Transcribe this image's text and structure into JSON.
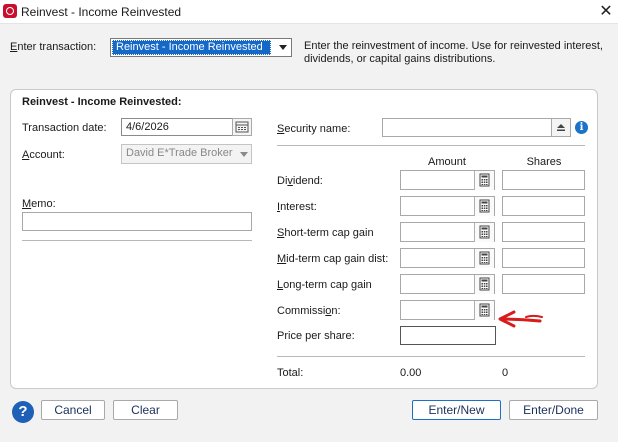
{
  "window": {
    "title": "Reinvest - Income Reinvested",
    "close_glyph": "✕",
    "app_icon": "quicken-logo"
  },
  "header": {
    "enter_transaction_label": "Enter transaction:",
    "enter_transaction_value": "Reinvest - Income Reinvested",
    "description": "Enter the reinvestment of income. Use for reinvested interest, dividends, or capital gains distributions."
  },
  "form": {
    "section_title": "Reinvest - Income Reinvested:",
    "transaction_date_label": "Transaction date:",
    "transaction_date_value": "4/6/2026",
    "account_label": "Account:",
    "account_value": "David E*Trade Broker",
    "memo_label": "Memo:",
    "memo_value": "",
    "security_name_label": "Security name:",
    "security_name_value": "",
    "info_glyph": "i",
    "amount_header": "Amount",
    "shares_header": "Shares",
    "rows": [
      {
        "label": "Dividend:",
        "amount": "",
        "shares": ""
      },
      {
        "label": "Interest:",
        "amount": "",
        "shares": ""
      },
      {
        "label": "Short-term cap gain",
        "amount": "",
        "shares": ""
      },
      {
        "label": "Mid-term cap gain dist:",
        "amount": "",
        "shares": ""
      },
      {
        "label": "Long-term cap gain",
        "amount": "",
        "shares": ""
      }
    ],
    "commission_label": "Commission:",
    "commission_value": "",
    "price_per_share_label": "Price per share:",
    "price_per_share_value": "",
    "total_label": "Total:",
    "total_amount": "0.00",
    "total_shares": "0"
  },
  "footer": {
    "help_glyph": "?",
    "cancel_label": "Cancel",
    "clear_label": "Clear",
    "enter_new_label": "Enter/New",
    "enter_done_label": "Enter/Done"
  },
  "colors": {
    "accent": "#1468c8",
    "annotation": "#d81c1c"
  }
}
